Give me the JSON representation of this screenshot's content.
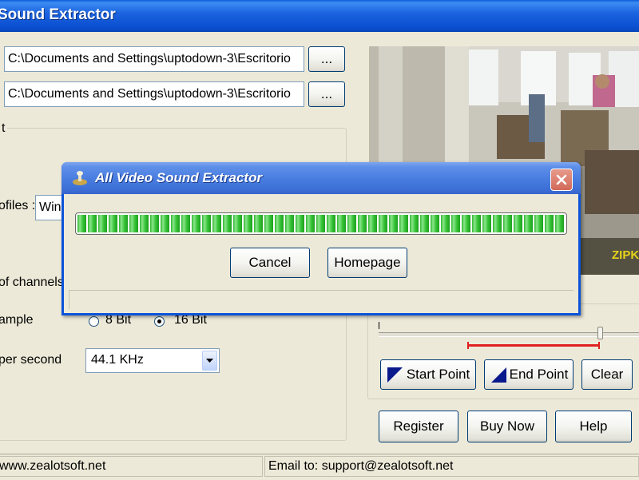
{
  "window": {
    "title": "Sound Extractor"
  },
  "input_path": "C:\\Documents and Settings\\uptodown-3\\Escritorio",
  "output_path": "C:\\Documents and Settings\\uptodown-3\\Escritorio",
  "browse_label": "...",
  "settings": {
    "group_caption": "t",
    "profiles_label": "ofiles :",
    "profiles_value": "Win",
    "channels_label": "of channels",
    "bits_label": "ample",
    "bit_options": [
      {
        "label": "8 Bit",
        "selected": false
      },
      {
        "label": "16 Bit",
        "selected": true
      }
    ],
    "samples_label": "per second",
    "samples_value": "44.1 KHz"
  },
  "preview": {
    "watermark": "ZIPK"
  },
  "trim": {
    "position_fraction": 0.85,
    "selection_start_fraction": 0.34,
    "selection_end_fraction": 0.85,
    "start_label": "Start Point",
    "end_label": "End Point",
    "clear_label": "Clear"
  },
  "actions": {
    "register": "Register",
    "buy_now": "Buy Now",
    "help": "Help"
  },
  "statusbar": {
    "website": "www.zealotsoft.net",
    "email": "Email to: support@zealotsoft.net"
  },
  "dialog": {
    "title": "All Video Sound Extractor",
    "progress_fraction": 1.0,
    "cancel_label": "Cancel",
    "homepage_label": "Homepage"
  },
  "colors": {
    "xp_blue": "#0b53d9",
    "progress_green": "#2fb52f",
    "selection_red": "#e02020"
  }
}
